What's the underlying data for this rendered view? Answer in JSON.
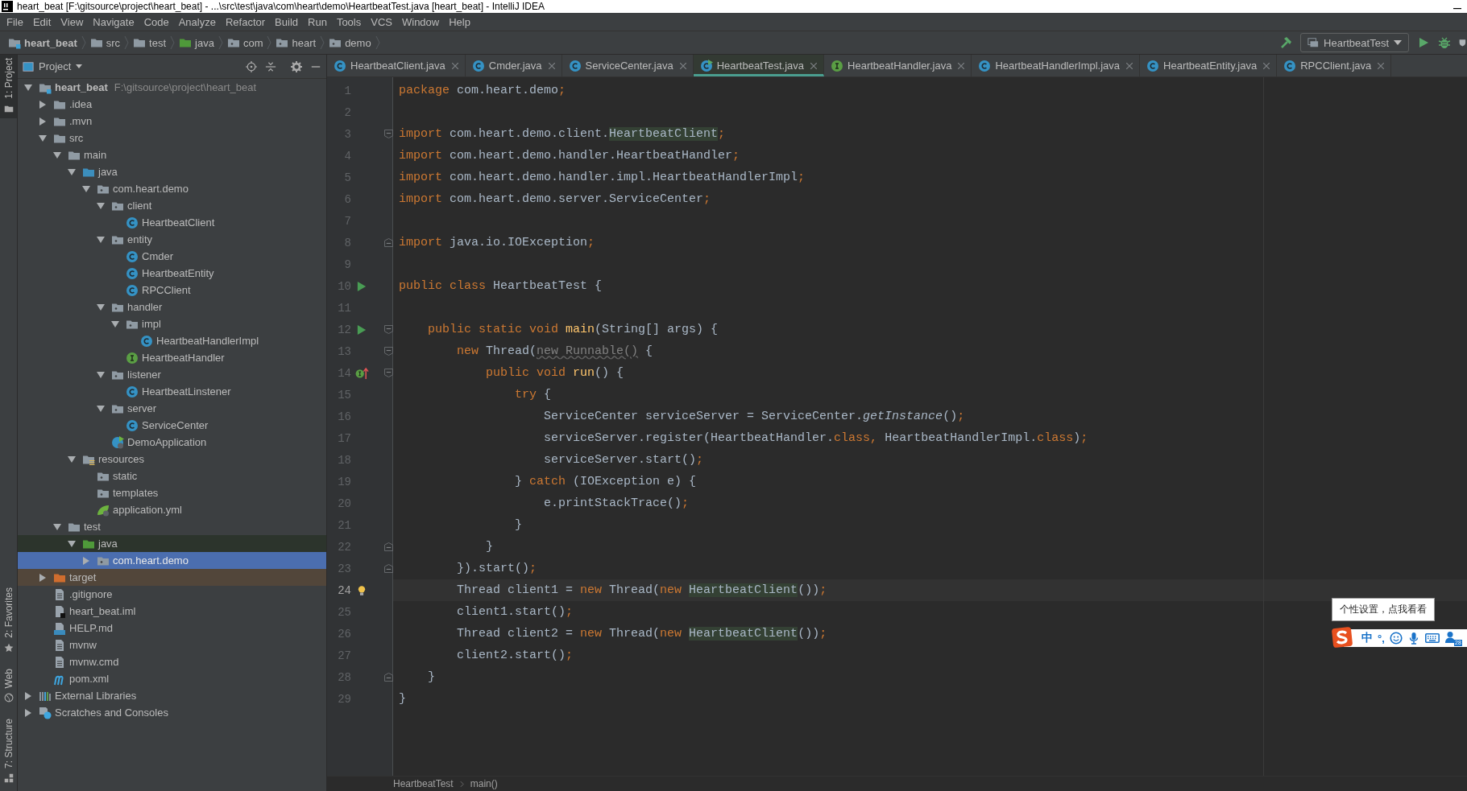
{
  "window": {
    "title": "heart_beat [F:\\gitsource\\project\\heart_beat] - ...\\src\\test\\java\\com\\heart\\demo\\HeartbeatTest.java [heart_beat] - IntelliJ IDEA"
  },
  "menu": [
    "File",
    "Edit",
    "View",
    "Navigate",
    "Code",
    "Analyze",
    "Refactor",
    "Build",
    "Run",
    "Tools",
    "VCS",
    "Window",
    "Help"
  ],
  "breadcrumbs": [
    {
      "label": "heart_beat",
      "kind": "module"
    },
    {
      "label": "src",
      "kind": "folder"
    },
    {
      "label": "test",
      "kind": "folder"
    },
    {
      "label": "java",
      "kind": "test-folder"
    },
    {
      "label": "com",
      "kind": "package"
    },
    {
      "label": "heart",
      "kind": "package"
    },
    {
      "label": "demo",
      "kind": "package"
    }
  ],
  "run_config": "HeartbeatTest",
  "tool_strip": {
    "top": [
      {
        "label": "1: Project",
        "selected": true
      }
    ],
    "bottom": [
      {
        "label": "2: Favorites",
        "kind": "star",
        "selected": false
      },
      {
        "label": "Web",
        "kind": "globe",
        "selected": false
      },
      {
        "label": "7: Structure",
        "kind": "structure",
        "selected": false
      }
    ]
  },
  "project": {
    "title": "Project",
    "tree": [
      {
        "label": "heart_beat",
        "path": "F:\\gitsource\\project\\heart_beat",
        "kind": "module",
        "expanded": true,
        "selected": false,
        "children": [
          {
            "label": ".idea",
            "kind": "folder",
            "expanded": false,
            "selected": false
          },
          {
            "label": ".mvn",
            "kind": "folder",
            "expanded": false,
            "selected": false
          },
          {
            "label": "src",
            "kind": "folder",
            "expanded": true,
            "selected": false,
            "children": [
              {
                "label": "main",
                "kind": "folder",
                "expanded": true,
                "selected": false,
                "children": [
                  {
                    "label": "java",
                    "kind": "src-folder",
                    "expanded": true,
                    "selected": false,
                    "children": [
                      {
                        "label": "com.heart.demo",
                        "kind": "package",
                        "expanded": true,
                        "selected": false,
                        "children": [
                          {
                            "label": "client",
                            "kind": "package",
                            "expanded": true,
                            "selected": false,
                            "children": [
                              {
                                "label": "HeartbeatClient",
                                "kind": "class",
                                "selected": false
                              }
                            ]
                          },
                          {
                            "label": "entity",
                            "kind": "package",
                            "expanded": true,
                            "selected": false,
                            "children": [
                              {
                                "label": "Cmder",
                                "kind": "class",
                                "selected": false
                              },
                              {
                                "label": "HeartbeatEntity",
                                "kind": "class",
                                "selected": false
                              },
                              {
                                "label": "RPCClient",
                                "kind": "class",
                                "selected": false
                              }
                            ]
                          },
                          {
                            "label": "handler",
                            "kind": "package",
                            "expanded": true,
                            "selected": false,
                            "children": [
                              {
                                "label": "impl",
                                "kind": "package",
                                "expanded": true,
                                "selected": false,
                                "children": [
                                  {
                                    "label": "HeartbeatHandlerImpl",
                                    "kind": "class",
                                    "selected": false
                                  }
                                ]
                              },
                              {
                                "label": "HeartbeatHandler",
                                "kind": "interface",
                                "selected": false
                              }
                            ]
                          },
                          {
                            "label": "listener",
                            "kind": "package",
                            "expanded": true,
                            "selected": false,
                            "children": [
                              {
                                "label": "HeartbeatLinstener",
                                "kind": "class",
                                "selected": false
                              }
                            ]
                          },
                          {
                            "label": "server",
                            "kind": "package",
                            "expanded": true,
                            "selected": false,
                            "children": [
                              {
                                "label": "ServiceCenter",
                                "kind": "class",
                                "selected": false
                              }
                            ]
                          },
                          {
                            "label": "DemoApplication",
                            "kind": "spring-app",
                            "selected": false
                          }
                        ]
                      }
                    ]
                  },
                  {
                    "label": "resources",
                    "kind": "resources",
                    "expanded": true,
                    "selected": false,
                    "children": [
                      {
                        "label": "static",
                        "kind": "package",
                        "selected": false
                      },
                      {
                        "label": "templates",
                        "kind": "package",
                        "selected": false
                      },
                      {
                        "label": "application.yml",
                        "kind": "spring-yml",
                        "selected": false
                      }
                    ]
                  }
                ]
              },
              {
                "label": "test",
                "kind": "folder",
                "expanded": true,
                "selected": false,
                "children": [
                  {
                    "label": "java",
                    "kind": "test-folder",
                    "expanded": true,
                    "selected": false,
                    "test_root": true,
                    "children": [
                      {
                        "label": "com.heart.demo",
                        "kind": "package",
                        "expanded": false,
                        "selected": true
                      }
                    ]
                  }
                ]
              }
            ]
          },
          {
            "label": "target",
            "kind": "excluded-folder",
            "expanded": false,
            "selected": false,
            "excluded": true
          },
          {
            "label": ".gitignore",
            "kind": "text-file",
            "selected": false
          },
          {
            "label": "heart_beat.iml",
            "kind": "iml",
            "selected": false
          },
          {
            "label": "HELP.md",
            "kind": "md",
            "selected": false
          },
          {
            "label": "mvnw",
            "kind": "text-file",
            "selected": false
          },
          {
            "label": "mvnw.cmd",
            "kind": "text-file",
            "selected": false
          },
          {
            "label": "pom.xml",
            "kind": "maven",
            "selected": false
          }
        ]
      },
      {
        "label": "External Libraries",
        "kind": "libraries",
        "expanded": false,
        "selected": false
      },
      {
        "label": "Scratches and Consoles",
        "kind": "scratches",
        "expanded": false,
        "selected": false
      }
    ]
  },
  "tabs": [
    {
      "label": "HeartbeatClient.java",
      "kind": "class",
      "selected": false
    },
    {
      "label": "Cmder.java",
      "kind": "class",
      "selected": false
    },
    {
      "label": "ServiceCenter.java",
      "kind": "class",
      "selected": false
    },
    {
      "label": "HeartbeatTest.java",
      "kind": "test-class",
      "selected": true
    },
    {
      "label": "HeartbeatHandler.java",
      "kind": "interface",
      "selected": false
    },
    {
      "label": "HeartbeatHandlerImpl.java",
      "kind": "class",
      "selected": false
    },
    {
      "label": "HeartbeatEntity.java",
      "kind": "class",
      "selected": false
    },
    {
      "label": "RPCClient.java",
      "kind": "class",
      "selected": false
    }
  ],
  "code": [
    {
      "number": "1",
      "tokens": [
        {
          "text": "package",
          "kind": "kw"
        },
        {
          "text": " com.heart.demo",
          "kind": "txt"
        },
        {
          "text": ";",
          "kind": "semi"
        }
      ]
    },
    {
      "number": "2"
    },
    {
      "number": "3",
      "fold": {
        "kind": "start"
      },
      "tokens": [
        {
          "text": "import",
          "kind": "kw"
        },
        {
          "text": " com.heart.demo.client.",
          "kind": "txt"
        },
        {
          "text": "HeartbeatClient",
          "kind": "use"
        },
        {
          "text": ";",
          "kind": "semi"
        }
      ]
    },
    {
      "number": "4",
      "tokens": [
        {
          "text": "import",
          "kind": "kw"
        },
        {
          "text": " com.heart.demo.handler.HeartbeatHandler",
          "kind": "txt"
        },
        {
          "text": ";",
          "kind": "semi"
        }
      ]
    },
    {
      "number": "5",
      "tokens": [
        {
          "text": "import",
          "kind": "kw"
        },
        {
          "text": " com.heart.demo.handler.impl.HeartbeatHandlerImpl",
          "kind": "txt"
        },
        {
          "text": ";",
          "kind": "semi"
        }
      ]
    },
    {
      "number": "6",
      "tokens": [
        {
          "text": "import",
          "kind": "kw"
        },
        {
          "text": " com.heart.demo.server.ServiceCenter",
          "kind": "txt"
        },
        {
          "text": ";",
          "kind": "semi"
        }
      ]
    },
    {
      "number": "7"
    },
    {
      "number": "8",
      "fold": {
        "kind": "end"
      },
      "tokens": [
        {
          "text": "import",
          "kind": "kw"
        },
        {
          "text": " java.io.IOException",
          "kind": "txt"
        },
        {
          "text": ";",
          "kind": "semi"
        }
      ]
    },
    {
      "number": "9"
    },
    {
      "number": "10",
      "gutter": {
        "kind": "run"
      },
      "tokens": [
        {
          "text": "public class",
          "kind": "kw"
        },
        {
          "text": " HeartbeatTest {",
          "kind": "txt"
        }
      ]
    },
    {
      "number": "11"
    },
    {
      "number": "12",
      "gutter": {
        "kind": "run"
      },
      "fold": {
        "kind": "start"
      },
      "tokens": [
        {
          "text": "    public static void ",
          "kind": "kw"
        },
        {
          "text": "main",
          "kind": "fn"
        },
        {
          "text": "(String[] args) {",
          "kind": "txt"
        }
      ]
    },
    {
      "number": "13",
      "fold": {
        "kind": "start"
      },
      "tokens": [
        {
          "text": "        new",
          "kind": "kw"
        },
        {
          "text": " Thread(",
          "kind": "txt"
        },
        {
          "text": "new Runnable()",
          "kind": "dim"
        },
        {
          "text": " {",
          "kind": "txt"
        }
      ]
    },
    {
      "number": "14",
      "gutter": {
        "kind": "implements"
      },
      "fold": {
        "kind": "start"
      },
      "tokens": [
        {
          "text": "            public void ",
          "kind": "kw"
        },
        {
          "text": "run",
          "kind": "fn"
        },
        {
          "text": "() {",
          "kind": "txt"
        }
      ]
    },
    {
      "number": "15",
      "tokens": [
        {
          "text": "                try",
          "kind": "kw"
        },
        {
          "text": " {",
          "kind": "txt"
        }
      ]
    },
    {
      "number": "16",
      "tokens": [
        {
          "text": "                    ServiceCenter serviceServer = ServiceCenter.",
          "kind": "txt"
        },
        {
          "text": "getInstance",
          "kind": "st"
        },
        {
          "text": "()",
          "kind": "txt"
        },
        {
          "text": ";",
          "kind": "semi"
        }
      ]
    },
    {
      "number": "17",
      "tokens": [
        {
          "text": "                    serviceServer.register(HeartbeatHandler.",
          "kind": "txt"
        },
        {
          "text": "class",
          "kind": "kw"
        },
        {
          "text": ",",
          "kind": "semi"
        },
        {
          "text": " HeartbeatHandlerImpl.",
          "kind": "txt"
        },
        {
          "text": "class",
          "kind": "kw"
        },
        {
          "text": ")",
          "kind": "txt"
        },
        {
          "text": ";",
          "kind": "semi"
        }
      ]
    },
    {
      "number": "18",
      "tokens": [
        {
          "text": "                    serviceServer.start()",
          "kind": "txt"
        },
        {
          "text": ";",
          "kind": "semi"
        }
      ]
    },
    {
      "number": "19",
      "tokens": [
        {
          "text": "                } ",
          "kind": "txt"
        },
        {
          "text": "catch",
          "kind": "kw"
        },
        {
          "text": " (IOException e) {",
          "kind": "txt"
        }
      ]
    },
    {
      "number": "20",
      "tokens": [
        {
          "text": "                    e.printStackTrace()",
          "kind": "txt"
        },
        {
          "text": ";",
          "kind": "semi"
        }
      ]
    },
    {
      "number": "21",
      "tokens": [
        {
          "text": "                }",
          "kind": "txt"
        }
      ]
    },
    {
      "number": "22",
      "fold": {
        "kind": "end"
      },
      "tokens": [
        {
          "text": "            }",
          "kind": "txt"
        }
      ]
    },
    {
      "number": "23",
      "fold": {
        "kind": "end"
      },
      "tokens": [
        {
          "text": "        }).start()",
          "kind": "txt"
        },
        {
          "text": ";",
          "kind": "semi"
        }
      ]
    },
    {
      "number": "24",
      "gutter": {
        "kind": "bulb"
      },
      "current": true,
      "tokens": [
        {
          "text": "        Thread client1 = ",
          "kind": "txt"
        },
        {
          "text": "new",
          "kind": "kw"
        },
        {
          "text": " Thread(",
          "kind": "txt"
        },
        {
          "text": "new ",
          "kind": "kw"
        },
        {
          "text": "HeartbeatClient",
          "kind": "use"
        },
        {
          "text": "())",
          "kind": "txt"
        },
        {
          "text": ";",
          "kind": "semi"
        }
      ]
    },
    {
      "number": "25",
      "tokens": [
        {
          "text": "        client1.start()",
          "kind": "txt"
        },
        {
          "text": ";",
          "kind": "semi"
        }
      ]
    },
    {
      "number": "26",
      "tokens": [
        {
          "text": "        Thread client2 = ",
          "kind": "txt"
        },
        {
          "text": "new",
          "kind": "kw"
        },
        {
          "text": " Thread(",
          "kind": "txt"
        },
        {
          "text": "new ",
          "kind": "kw"
        },
        {
          "text": "HeartbeatClient",
          "kind": "use"
        },
        {
          "text": "())",
          "kind": "txt"
        },
        {
          "text": ";",
          "kind": "semi"
        }
      ]
    },
    {
      "number": "27",
      "tokens": [
        {
          "text": "        client2.start()",
          "kind": "txt"
        },
        {
          "text": ";",
          "kind": "semi"
        }
      ]
    },
    {
      "number": "28",
      "fold": {
        "kind": "end"
      },
      "tokens": [
        {
          "text": "    }",
          "kind": "txt"
        }
      ]
    },
    {
      "number": "29",
      "tokens": [
        {
          "text": "}",
          "kind": "txt"
        }
      ]
    }
  ],
  "editor_breadcrumbs": [
    "HeartbeatTest",
    "main()"
  ],
  "ime": {
    "tooltip": "个性设置，点我看看",
    "mode": "中",
    "punctuation": "°,",
    "badge": "28"
  }
}
